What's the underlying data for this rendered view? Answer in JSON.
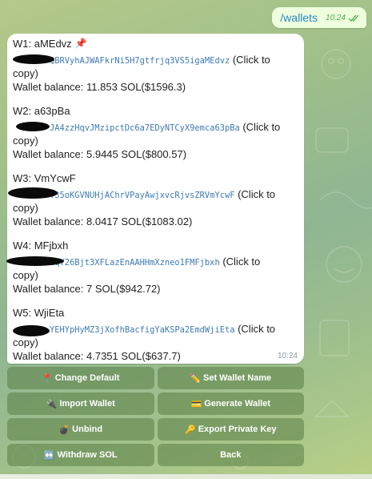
{
  "outgoing": {
    "text": "/wallets",
    "time": "10:24"
  },
  "message": {
    "time": "10:24",
    "wallets": [
      {
        "title": "W1: aMEdvz",
        "pin_icon": "pushpin-icon",
        "address": "QBRVyhAJWAFkrNi5H7gtfrjq3VS5igaMEdvz",
        "copy_text": "(Click to",
        "copy_text_2": "copy)",
        "balance": "Wallet balance: 11.853 SOL($1596.3)"
      },
      {
        "title": "W2: a63pBa",
        "address": "JA4zzHqvJMzipctDc6a7EDyNTCyX9emca63pBa",
        "copy_text": "(Click to",
        "copy_text_2": "copy)",
        "balance": "Wallet balance: 5.9445 SOL($800.57)"
      },
      {
        "title": "W3: VmYcwF",
        "address": ":35oKGVNUHjAChrVPayAwjxvcRjvsZRVmYcwF",
        "copy_text": "(Click to",
        "copy_text_2": "copy)",
        "balance": "Wallet balance: 8.0417 SOL($1083.02)"
      },
      {
        "title": "W4: MFjbxh",
        "address": "2qY26Bjt3XFLazEnAAHHmXzneo1FMFjbxh",
        "copy_text": "(Click to",
        "copy_text_2": "copy)",
        "balance": "Wallet balance: 7 SOL($942.72)"
      },
      {
        "title": "W5: WjiEta",
        "address": "YEHYpHyMZ3jXofhBacfigYaKSPa2EmdWjiEta",
        "copy_text": "(Click to",
        "copy_text_2": "copy)",
        "balance": "Wallet balance: 4.7351 SOL($637.7)"
      }
    ]
  },
  "keyboard": [
    [
      {
        "label": "Change Default",
        "icon": "📍"
      },
      {
        "label": "Set Wallet Name",
        "icon": "✏️"
      }
    ],
    [
      {
        "label": "Import Wallet",
        "icon": "🔌"
      },
      {
        "label": "Generate Wallet",
        "icon": "💳"
      }
    ],
    [
      {
        "label": "Unbind",
        "icon": "💣"
      },
      {
        "label": "Export Private Key",
        "icon": "🔑"
      }
    ],
    [
      {
        "label": "Withdraw SOL",
        "icon": "↔️"
      },
      {
        "label": "Back",
        "icon": ""
      }
    ]
  ]
}
